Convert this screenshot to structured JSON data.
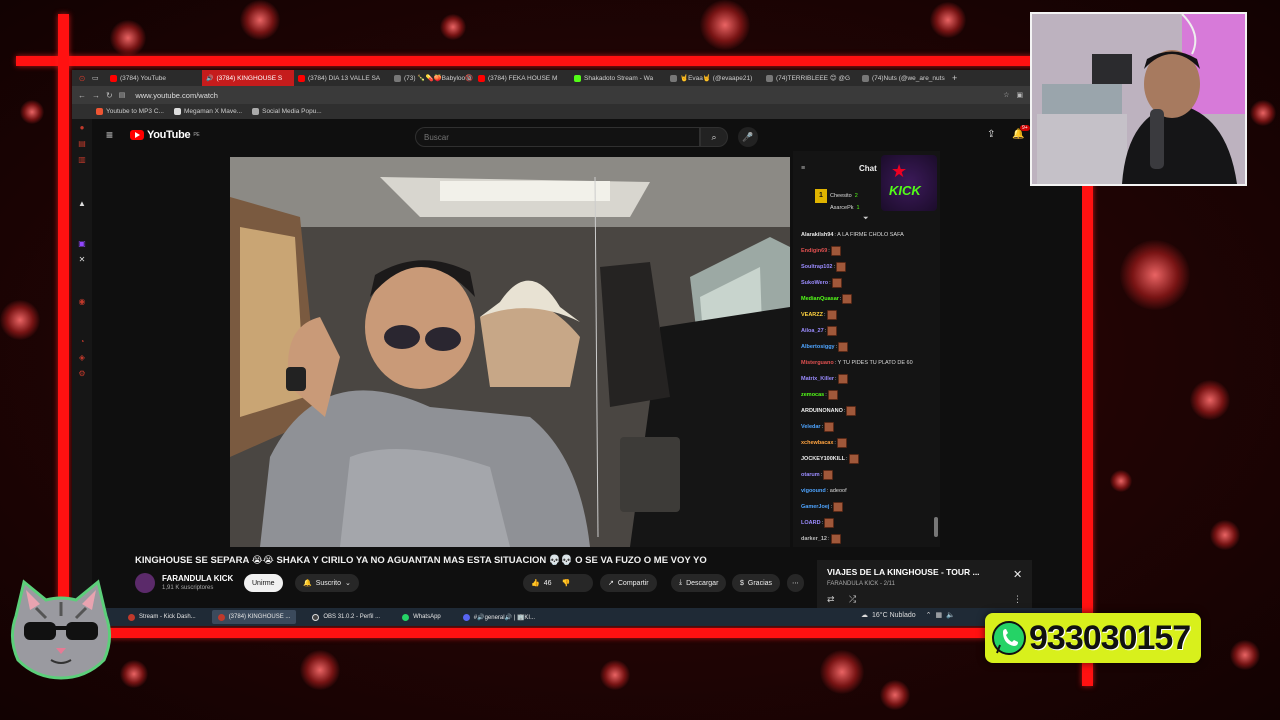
{
  "browser": {
    "tabs": [
      {
        "label": "(3784) YouTube",
        "active": false,
        "color": "#ff0000"
      },
      {
        "label": "(3784) KINGHOUSE S",
        "active": true,
        "color": "#ff0000"
      },
      {
        "label": "(3784) DIA 13 VALLE SA",
        "active": false,
        "color": "#ff0000"
      },
      {
        "label": "(73) 🍾💊🍑Babyloo🔞",
        "active": false,
        "color": "#777"
      },
      {
        "label": "(3784) FEKA HOUSE M",
        "active": false,
        "color": "#ff0000"
      },
      {
        "label": "Shakadoto Stream - Wa",
        "active": false,
        "color": "#53fc18"
      },
      {
        "label": "🤘Evaa🤘 (@evaape21)",
        "active": false,
        "color": "#777"
      },
      {
        "label": "(74)TERRIBLEEE 😊 @G",
        "active": false,
        "color": "#777"
      },
      {
        "label": "(74)Nuts (@we_are_nuts",
        "active": false,
        "color": "#777"
      }
    ],
    "url": "www.youtube.com/watch",
    "bookmarks": [
      "Youtube to MP3 C...",
      "Megaman X Mave...",
      "Social Media Popu..."
    ]
  },
  "youtube": {
    "logo": "YouTube",
    "region": "PE",
    "search_placeholder": "Buscar",
    "notif_count": "9+",
    "chat_title": "Chat",
    "chat_top": [
      {
        "name": "Cheesito",
        "count": "2"
      },
      {
        "name": "AsarcePk",
        "count": "1"
      }
    ],
    "chat_overlay": "KICK",
    "chat": [
      {
        "user": "Alarakilsh94",
        "text": ": A LA FIRME CHOLO SAFA",
        "color": "#e8e8e8",
        "emote": false
      },
      {
        "user": "Endigin69",
        "text": ":",
        "color": "#e05050",
        "emote": true
      },
      {
        "user": "Soultrap102",
        "text": ":",
        "color": "#9b8cff",
        "emote": true
      },
      {
        "user": "SukoWero",
        "text": ":",
        "color": "#9b8cff",
        "emote": true
      },
      {
        "user": "MedianQuasar",
        "text": ":",
        "color": "#53fc18",
        "emote": true
      },
      {
        "user": "VEARZZ",
        "text": ":",
        "color": "#ffd23f",
        "emote": true
      },
      {
        "user": "Ailoa_27",
        "text": ":",
        "color": "#9b8cff",
        "emote": true
      },
      {
        "user": "Albertosiggy",
        "text": ":",
        "color": "#4ea4ff",
        "emote": true
      },
      {
        "user": "Misterguano",
        "text": ": Y TU PIDES TU PLATO DE 60",
        "color": "#e05050",
        "emote": false
      },
      {
        "user": "Matrix_Killer",
        "text": ":",
        "color": "#9b8cff",
        "emote": true
      },
      {
        "user": "zemocas",
        "text": ":",
        "color": "#53fc18",
        "emote": true
      },
      {
        "user": "ARDUINONANO",
        "text": ":",
        "color": "#eeeeee",
        "emote": true
      },
      {
        "user": "Veledar",
        "text": ":",
        "color": "#4ea4ff",
        "emote": true
      },
      {
        "user": "xchewbacax",
        "text": ":",
        "color": "#ffa33f",
        "emote": true
      },
      {
        "user": "JOCKEY100KILL",
        "text": ":",
        "color": "#eeeeee",
        "emote": true
      },
      {
        "user": "otarum",
        "text": ":",
        "color": "#9b8cff",
        "emote": true
      },
      {
        "user": "vigoound",
        "text": ": adeoof",
        "color": "#4ea4ff",
        "emote": false
      },
      {
        "user": "GamerJoej",
        "text": ":",
        "color": "#4ea4ff",
        "emote": true
      },
      {
        "user": "LOARD",
        "text": ":",
        "color": "#9b8cff",
        "emote": true
      },
      {
        "user": "darker_12",
        "text": ":",
        "color": "#bbbbbb",
        "emote": true
      }
    ],
    "video_title": "KINGHOUSE SE SEPARA 😭😭 SHAKA Y CIRILO YA NO AGUANTAN MAS ESTA SITUACION 💀💀 O SE VA FUZO O ME VOY YO",
    "channel": {
      "name": "FARANDULA KICK",
      "subs": "1,91 K suscriptores"
    },
    "join_label": "Unirme",
    "subscribed_label": "Suscrito",
    "likes": "46",
    "share_label": "Compartir",
    "download_label": "Descargar",
    "thanks_label": "Gracias",
    "up_next": {
      "title": "VIAJES DE LA KINGHOUSE - TOUR ...",
      "sub": "FARANDULA KICK - 2/11"
    }
  },
  "taskbar": {
    "items": [
      {
        "label": "Stream - Kick Dash...",
        "active": false
      },
      {
        "label": "(3784) KINGHOUSE ...",
        "active": true
      },
      {
        "label": "OBS 31.0.2 - Perfil ...",
        "active": false
      },
      {
        "label": "WhatsApp",
        "active": false
      },
      {
        "label": "#🔊general🔊 | 🏢KI...",
        "active": false
      }
    ],
    "weather": "16°C  Nublado"
  },
  "overlay": {
    "whatsapp_number": "933030157"
  },
  "colors": {
    "frame_red": "#ff1111",
    "whatsapp_green": "#25d366",
    "whatsapp_badge": "#d8f01c",
    "kick_green": "#53fc18"
  }
}
